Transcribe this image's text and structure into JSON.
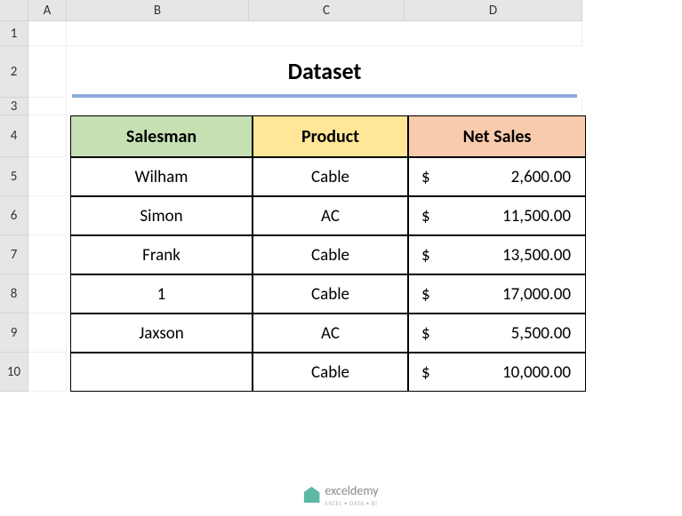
{
  "columns": {
    "A": "A",
    "B": "B",
    "C": "C",
    "D": "D"
  },
  "rows": {
    "r1": "1",
    "r2": "2",
    "r3": "3",
    "r4": "4",
    "r5": "5",
    "r6": "6",
    "r7": "7",
    "r8": "8",
    "r9": "9",
    "r10": "10"
  },
  "title": "Dataset",
  "headers": {
    "salesman": "Salesman",
    "product": "Product",
    "netsales": "Net Sales"
  },
  "currency": "$",
  "data": [
    {
      "salesman": "Wilham",
      "product": "Cable",
      "netsales": "2,600.00"
    },
    {
      "salesman": "Simon",
      "product": "AC",
      "netsales": "11,500.00"
    },
    {
      "salesman": "Frank",
      "product": "Cable",
      "netsales": "13,500.00"
    },
    {
      "salesman": "1",
      "product": "Cable",
      "netsales": "17,000.00"
    },
    {
      "salesman": "Jaxson",
      "product": "AC",
      "netsales": "5,500.00"
    },
    {
      "salesman": "",
      "product": "Cable",
      "netsales": "10,000.00"
    }
  ],
  "watermark": {
    "brand": "exceldemy",
    "tagline": "EXCEL • DATA • BI"
  }
}
